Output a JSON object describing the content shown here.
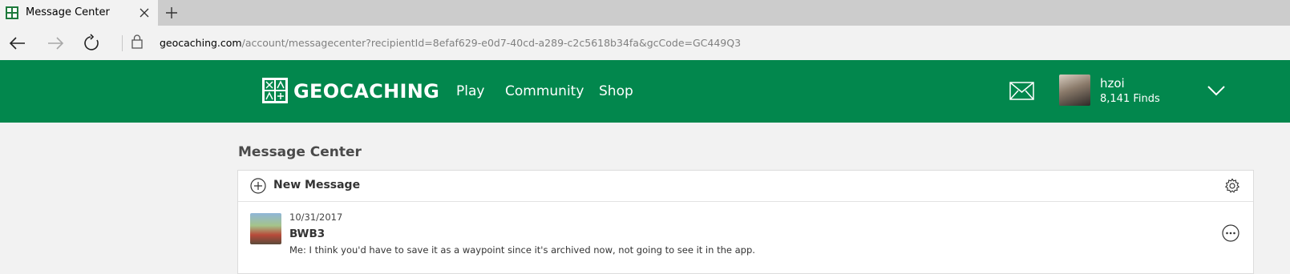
{
  "browser": {
    "tab": {
      "title": "Message Center",
      "favicon": "geocaching-favicon",
      "close_icon": "close-icon"
    },
    "new_tab_icon": "plus-icon",
    "nav": {
      "back_icon": "back-arrow-icon",
      "forward_icon": "forward-arrow-icon",
      "refresh_icon": "refresh-icon",
      "lock_icon": "lock-icon"
    },
    "url": {
      "host": "geocaching.com",
      "path": "/account/messagecenter?recipientId=8efaf629-e0d7-40cd-a289-c2c5618b34fa&gcCode=GC449Q3"
    }
  },
  "header": {
    "logo_text": "GEOCACHING",
    "nav": [
      {
        "label": "Play"
      },
      {
        "label": "Community"
      },
      {
        "label": "Shop"
      }
    ],
    "mail_icon": "envelope-icon",
    "user": {
      "name": "hzoi",
      "finds": "8,141 Finds"
    },
    "menu_icon": "chevron-down-icon",
    "colors": {
      "brand": "#02874d"
    }
  },
  "main": {
    "title": "Message Center",
    "toolbar": {
      "new_message_label": "New Message",
      "add_icon": "plus-circle-icon",
      "settings_icon": "gear-icon"
    },
    "messages": [
      {
        "date": "10/31/2017",
        "sender": "BWB3",
        "preview": "Me: I think you'd have to save it as a waypoint since it's archived now, not going to see it in the app.",
        "more_icon": "more-options-icon"
      }
    ]
  }
}
